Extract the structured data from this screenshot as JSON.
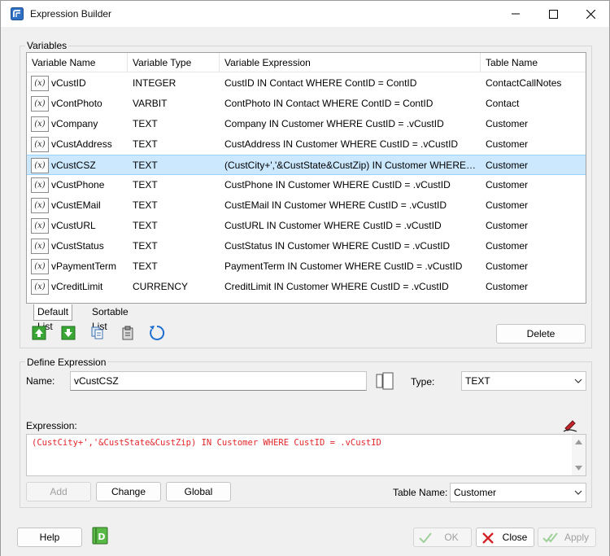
{
  "window": {
    "title": "Expression Builder"
  },
  "variables": {
    "group_label": "Variables",
    "columns": [
      "Variable Name",
      "Variable Type",
      "Variable Expression",
      "Table Name"
    ],
    "rows": [
      {
        "name": "vCustID",
        "type": "INTEGER",
        "expression": "CustID IN Contact WHERE ContID = ContID",
        "table": "ContactCallNotes"
      },
      {
        "name": "vContPhoto",
        "type": "VARBIT",
        "expression": "ContPhoto IN Contact WHERE ContID = ContID",
        "table": "Contact"
      },
      {
        "name": "vCompany",
        "type": "TEXT",
        "expression": "Company IN Customer WHERE CustID = .vCustID",
        "table": "Customer"
      },
      {
        "name": "vCustAddress",
        "type": "TEXT",
        "expression": "CustAddress IN Customer WHERE CustID = .vCustID",
        "table": "Customer"
      },
      {
        "name": "vCustCSZ",
        "type": "TEXT",
        "expression": "(CustCity+','&CustState&CustZip) IN Customer WHERE ...",
        "table": "Customer"
      },
      {
        "name": "vCustPhone",
        "type": "TEXT",
        "expression": "CustPhone IN Customer WHERE CustID = .vCustID",
        "table": "Customer"
      },
      {
        "name": "vCustEMail",
        "type": "TEXT",
        "expression": "CustEMail IN Customer WHERE CustID = .vCustID",
        "table": "Customer"
      },
      {
        "name": "vCustURL",
        "type": "TEXT",
        "expression": "CustURL IN Customer WHERE CustID = .vCustID",
        "table": "Customer"
      },
      {
        "name": "vCustStatus",
        "type": "TEXT",
        "expression": "CustStatus IN Customer WHERE CustID = .vCustID",
        "table": "Customer"
      },
      {
        "name": "vPaymentTerm",
        "type": "TEXT",
        "expression": "PaymentTerm IN Customer WHERE CustID = .vCustID",
        "table": "Customer"
      },
      {
        "name": "vCreditLimit",
        "type": "CURRENCY",
        "expression": "CreditLimit IN Customer WHERE CustID = .vCustID",
        "table": "Customer"
      }
    ],
    "selected_index": 4,
    "row_icon_text": "(x)",
    "tabs": [
      "Default List",
      "Sortable List"
    ],
    "delete_label": "Delete"
  },
  "define": {
    "group_label": "Define Expression",
    "name_label": "Name:",
    "name_value": "vCustCSZ",
    "type_label": "Type:",
    "type_value": "TEXT",
    "expression_label": "Expression:",
    "expression_value": "(CustCity+','&CustState&CustZip) IN Customer WHERE CustID = .vCustID",
    "add_label": "Add",
    "change_label": "Change",
    "global_label": "Global",
    "table_name_label": "Table Name:",
    "table_name_value": "Customer"
  },
  "footer": {
    "help_label": "Help",
    "ok_label": "OK",
    "close_label": "Close",
    "apply_label": "Apply"
  },
  "colors": {
    "selection": "#cce8ff",
    "expression_text": "#e0262a",
    "accent": "#1e6fd0"
  }
}
